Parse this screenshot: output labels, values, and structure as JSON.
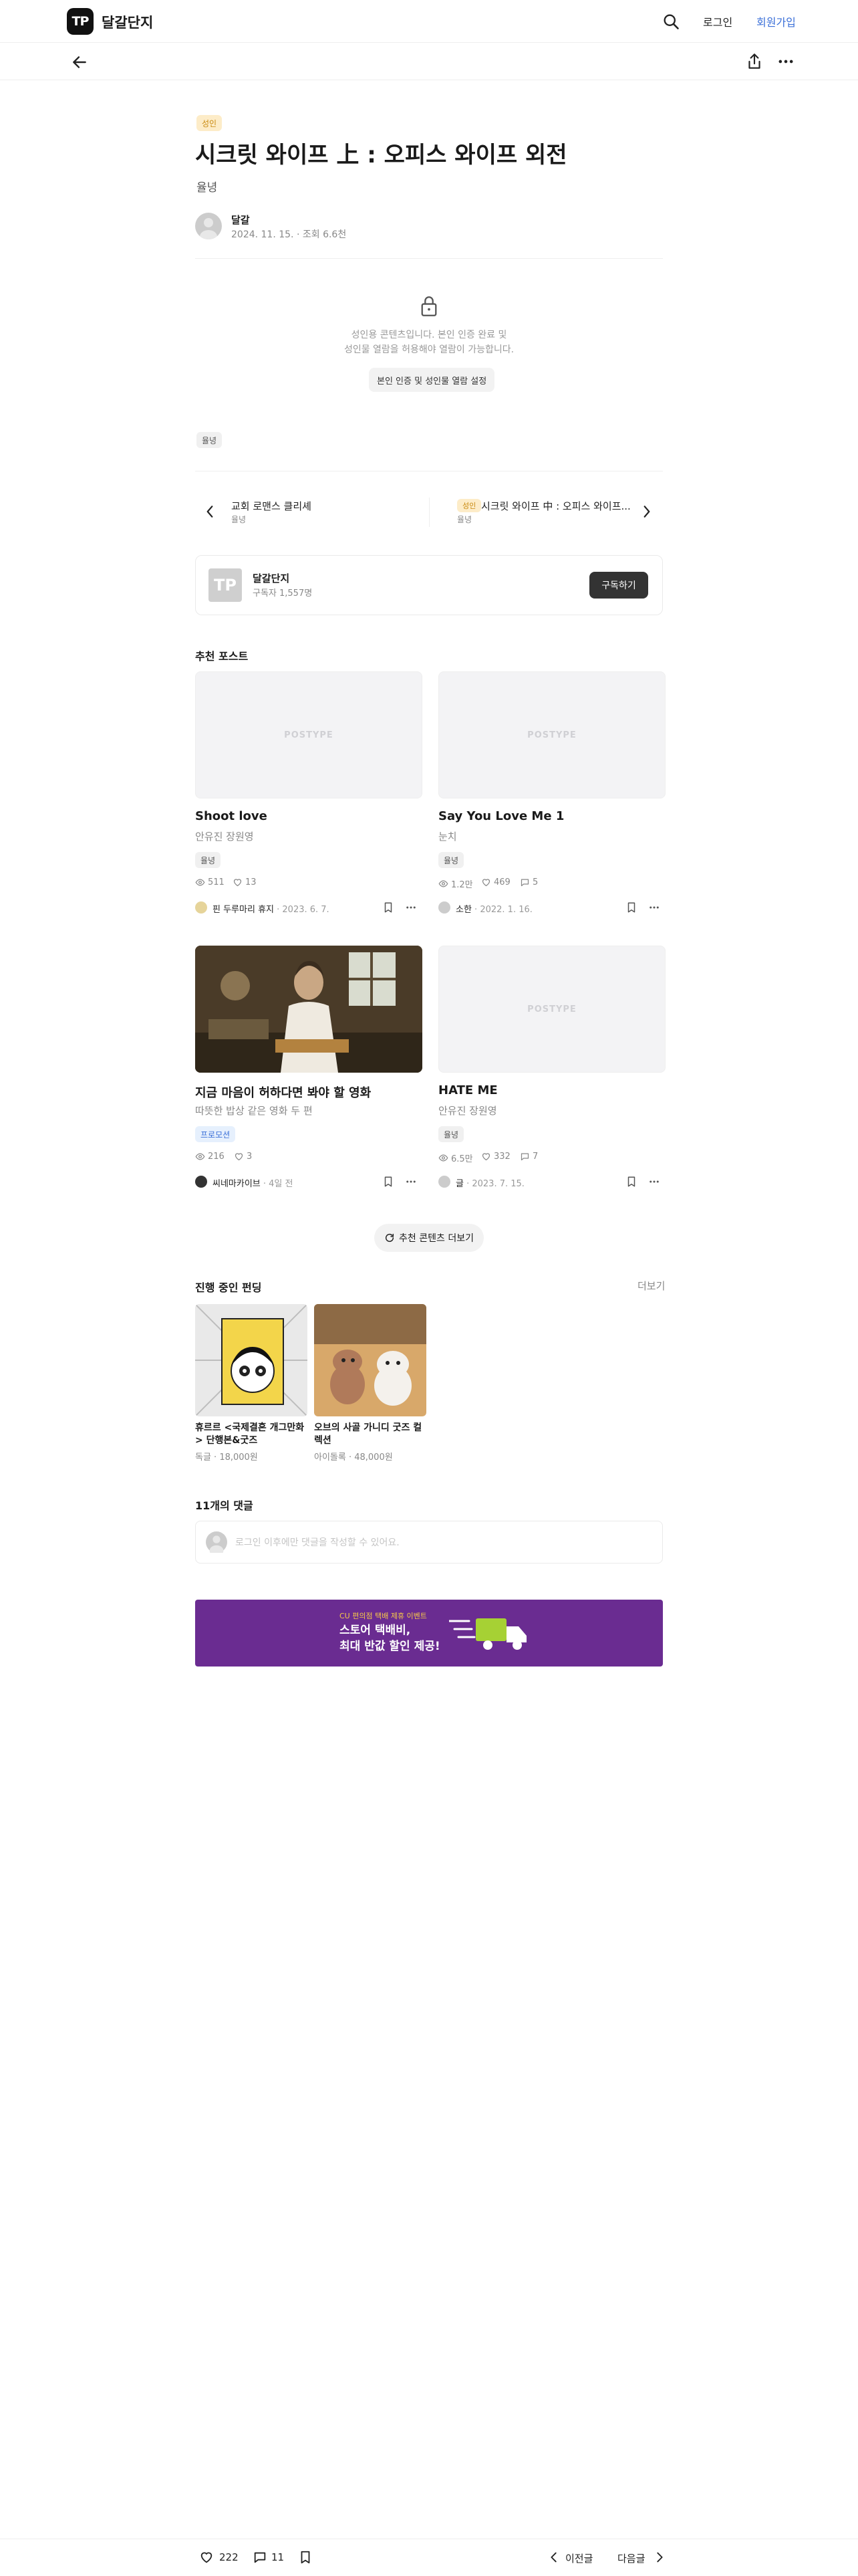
{
  "header": {
    "logo_text": "TP",
    "site_name": "달갈단지",
    "login": "로그인",
    "signup": "회원가입"
  },
  "post": {
    "adult_badge": "성인",
    "title": "시크릿 와이프 上 : 오피스 와이프 외전",
    "category": "율녕",
    "author": "달갈",
    "meta": "2024. 11. 15. · 조회 6.6천",
    "lock_line1": "성인용 콘텐츠입니다. 본인 인증 완료 및",
    "lock_line2": "성인물 열람을 허용해야 열람이 가능합니다.",
    "verify_button": "본인 인증 및 성인물 열람 설정",
    "tag": "율녕"
  },
  "post_nav": {
    "prev_title": "교회 로맨스 클리셰",
    "prev_sub": "율녕",
    "next_badge": "성인",
    "next_title": "시크릿 와이프 中 : 오피스 와이프...",
    "next_sub": "율녕"
  },
  "subscribe": {
    "logo_text": "TP",
    "name": "달갈단지",
    "count": "구독자 1,557명",
    "button": "구독하기"
  },
  "recommended": {
    "section_title": "추천 포스트",
    "placeholder": "POSTYPE",
    "cards": [
      {
        "title": "Shoot love",
        "author": "안유진 장원영",
        "tag": "율녕",
        "views": "511",
        "likes": "13",
        "byline_name": "핀 두루마리 휴지",
        "byline_date": " · 2023. 6. 7."
      },
      {
        "title": "Say You Love Me 1",
        "author": "눈치",
        "tag": "율녕",
        "views": "1.2만",
        "likes": "469",
        "comments": "5",
        "byline_name": "소한",
        "byline_date": " · 2022. 1. 16."
      },
      {
        "title": "지금 마음이 허하다면 봐야 할 영화",
        "author": "따뜻한 밥상 같은 영화 두 편",
        "tag": "프로모션",
        "views": "216",
        "likes": "3",
        "byline_name": "씨네마카이브",
        "byline_date": " · 4일 전"
      },
      {
        "title": "HATE ME",
        "author": "안유진 장원영",
        "tag": "율녕",
        "views": "6.5만",
        "likes": "332",
        "comments": "7",
        "byline_name": "글",
        "byline_date": " · 2023. 7. 15."
      }
    ],
    "more_button": "추천 콘텐츠 더보기"
  },
  "funding": {
    "section_title": "진행 중인 펀딩",
    "see_more": "더보기",
    "items": [
      {
        "title": "휴르르 <국제결혼 개그만화> 단행본&굿즈",
        "meta": "독글 · 18,000원"
      },
      {
        "title": "오브의 사골 가니디 굿즈 컬렉션",
        "meta": "아이돌록 · 48,000원"
      }
    ]
  },
  "comments": {
    "section_title": "11개의 댓글",
    "placeholder": "로그인 이후에만 댓글을 작성할 수 있어요."
  },
  "banner": {
    "small": "CU 편의점 택배 제휴 이벤트",
    "big1": "스토어 택배비,",
    "big2": "최대 반값 할인 제공!"
  },
  "bottom_bar": {
    "likes": "222",
    "comments": "11",
    "prev": "이전글",
    "next": "다음글"
  },
  "colors": {
    "accent": "#3a6fd8",
    "adult": "#fdecc8",
    "banner": "#6a2c91"
  }
}
